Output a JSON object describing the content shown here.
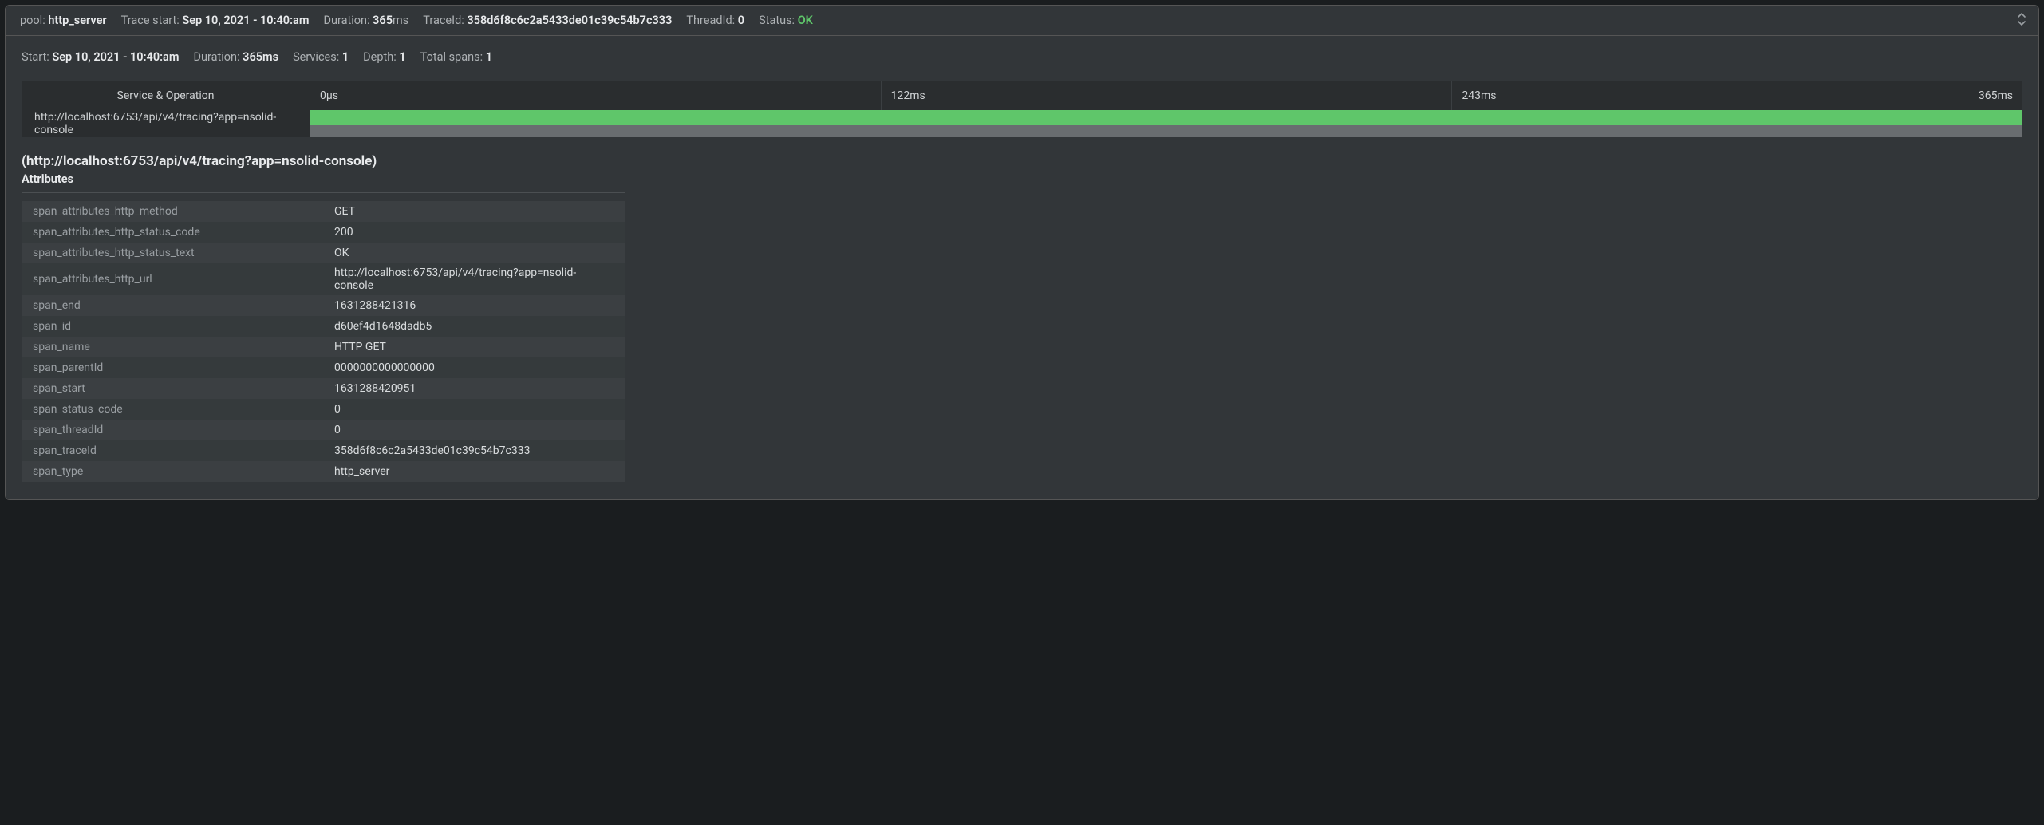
{
  "header": {
    "pool_label": "pool:",
    "pool_value": "http_server",
    "trace_start_label": "Trace start:",
    "trace_start_value": "Sep 10, 2021 - 10:40:am",
    "duration_label": "Duration:",
    "duration_value_num": "365",
    "duration_value_unit": "ms",
    "traceid_label": "TraceId:",
    "traceid_value": "358d6f8c6c2a5433de01c39c54b7c333",
    "threadid_label": "ThreadId:",
    "threadid_value": "0",
    "status_label": "Status:",
    "status_value": "OK"
  },
  "subheader": {
    "start_label": "Start:",
    "start_value": "Sep 10, 2021 - 10:40:am",
    "duration_label": "Duration:",
    "duration_value": "365ms",
    "services_label": "Services:",
    "services_value": "1",
    "depth_label": "Depth:",
    "depth_value": "1",
    "total_spans_label": "Total spans:",
    "total_spans_value": "1"
  },
  "timeline": {
    "service_header": "Service & Operation",
    "ticks": [
      "0µs",
      "122ms",
      "243ms",
      "365ms"
    ],
    "row_label": "http://localhost:6753/api/v4/tracing?app=nsolid-console"
  },
  "span_detail": {
    "title": "(http://localhost:6753/api/v4/tracing?app=nsolid-console)",
    "attributes_label": "Attributes"
  },
  "attrs": [
    {
      "k": "span_attributes_http_method",
      "v": "GET"
    },
    {
      "k": "span_attributes_http_status_code",
      "v": "200"
    },
    {
      "k": "span_attributes_http_status_text",
      "v": "OK"
    },
    {
      "k": "span_attributes_http_url",
      "v": "http://localhost:6753/api/v4/tracing?app=nsolid-console"
    },
    {
      "k": "span_end",
      "v": "1631288421316"
    },
    {
      "k": "span_id",
      "v": "d60ef4d1648dadb5"
    },
    {
      "k": "span_name",
      "v": "HTTP GET"
    },
    {
      "k": "span_parentId",
      "v": "0000000000000000"
    },
    {
      "k": "span_start",
      "v": "1631288420951"
    },
    {
      "k": "span_status_code",
      "v": "0"
    },
    {
      "k": "span_threadId",
      "v": "0"
    },
    {
      "k": "span_traceId",
      "v": "358d6f8c6c2a5433de01c39c54b7c333"
    },
    {
      "k": "span_type",
      "v": "http_server"
    }
  ]
}
